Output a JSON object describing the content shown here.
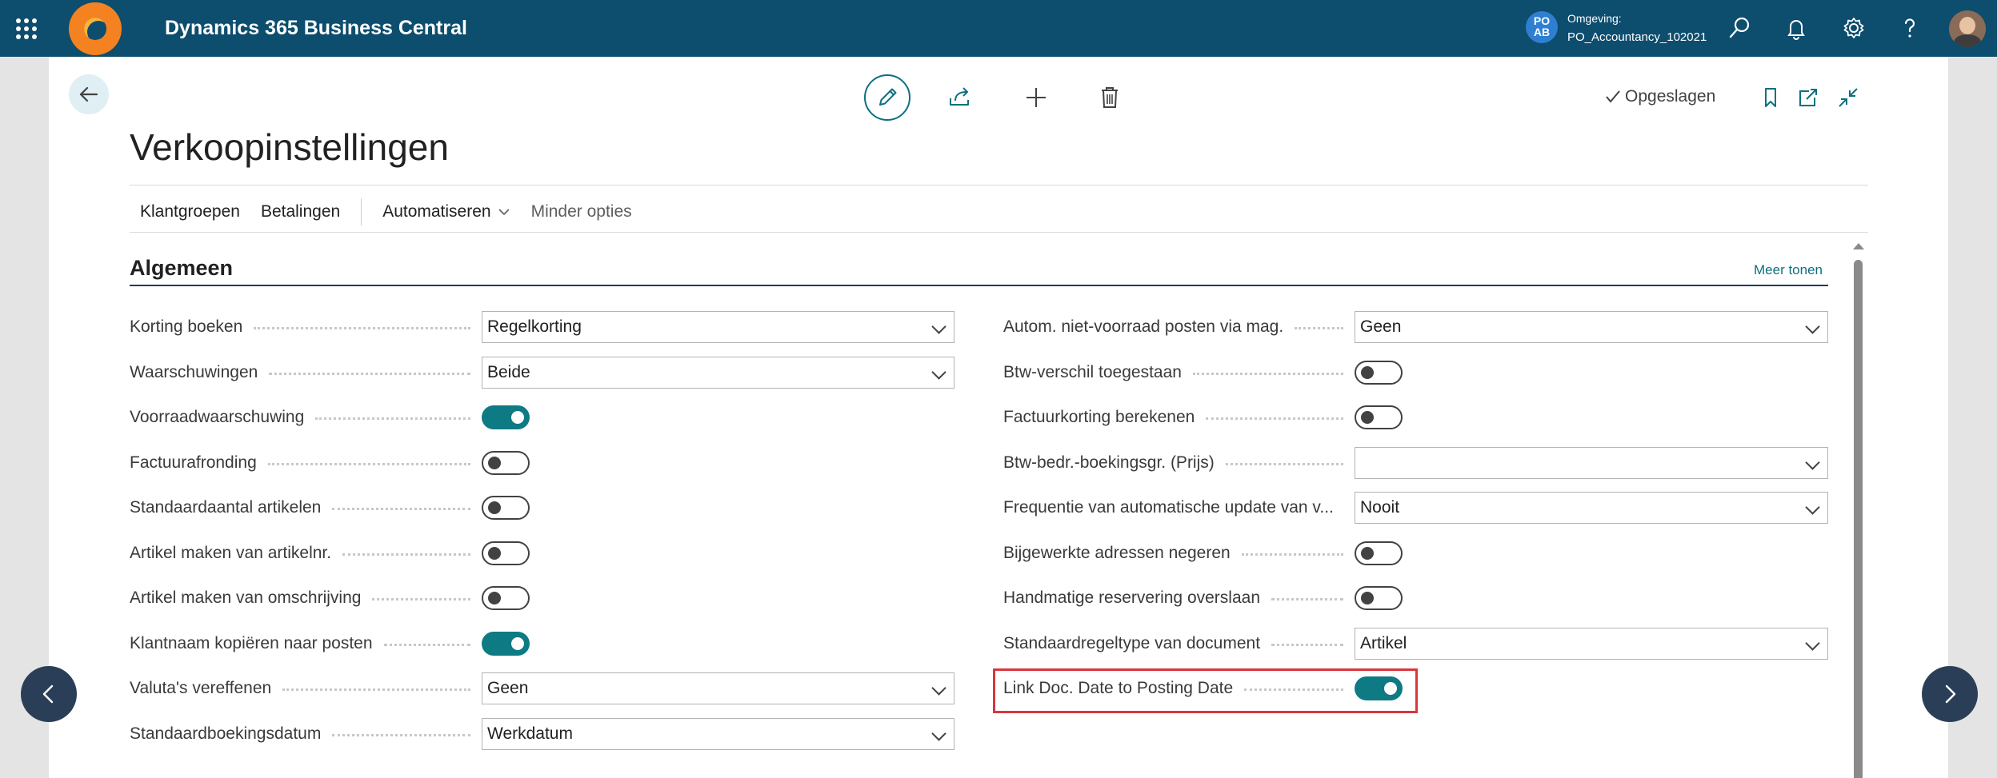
{
  "topbar": {
    "app_title": "Dynamics 365 Business Central",
    "env_initials_1": "PO",
    "env_initials_2": "AB",
    "env_label": "Omgeving:",
    "env_value": "PO_Accountancy_102021"
  },
  "toolbar": {
    "saved_label": "Opgeslagen"
  },
  "page": {
    "title": "Verkoopinstellingen"
  },
  "actions": {
    "customer_groups": "Klantgroepen",
    "payments": "Betalingen",
    "automate": "Automatiseren",
    "fewer_options": "Minder opties"
  },
  "section": {
    "title": "Algemeen",
    "more_link": "Meer tonen"
  },
  "left_fields": [
    {
      "label": "Korting boeken",
      "type": "select",
      "value": "Regelkorting"
    },
    {
      "label": "Waarschuwingen",
      "type": "select",
      "value": "Beide"
    },
    {
      "label": "Voorraadwaarschuwing",
      "type": "toggle",
      "on": true
    },
    {
      "label": "Factuurafronding",
      "type": "toggle",
      "on": false
    },
    {
      "label": "Standaardaantal artikelen",
      "type": "toggle",
      "on": false
    },
    {
      "label": "Artikel maken van artikelnr.",
      "type": "toggle",
      "on": false
    },
    {
      "label": "Artikel maken van omschrijving",
      "type": "toggle",
      "on": false
    },
    {
      "label": "Klantnaam kopiëren naar posten",
      "type": "toggle",
      "on": true
    },
    {
      "label": "Valuta's vereffenen",
      "type": "select",
      "value": "Geen"
    },
    {
      "label": "Standaardboekingsdatum",
      "type": "select",
      "value": "Werkdatum"
    }
  ],
  "right_fields": [
    {
      "label": "Autom. niet-voorraad posten via mag.",
      "type": "select",
      "value": "Geen"
    },
    {
      "label": "Btw-verschil toegestaan",
      "type": "toggle",
      "on": false
    },
    {
      "label": "Factuurkorting berekenen",
      "type": "toggle",
      "on": false
    },
    {
      "label": "Btw-bedr.-boekingsgr. (Prijs)",
      "type": "select",
      "value": ""
    },
    {
      "label": "Frequentie van automatische update van v...",
      "type": "select",
      "value": "Nooit"
    },
    {
      "label": "Bijgewerkte adressen negeren",
      "type": "toggle",
      "on": false
    },
    {
      "label": "Handmatige reservering overslaan",
      "type": "toggle",
      "on": false
    },
    {
      "label": "Standaardregeltype van document",
      "type": "select",
      "value": "Artikel"
    },
    {
      "label": "Link Doc. Date to Posting Date",
      "type": "toggle",
      "on": true
    }
  ],
  "colors": {
    "topbar": "#0d4d6e",
    "accent": "#0d7a84",
    "highlight": "#d9363e"
  }
}
